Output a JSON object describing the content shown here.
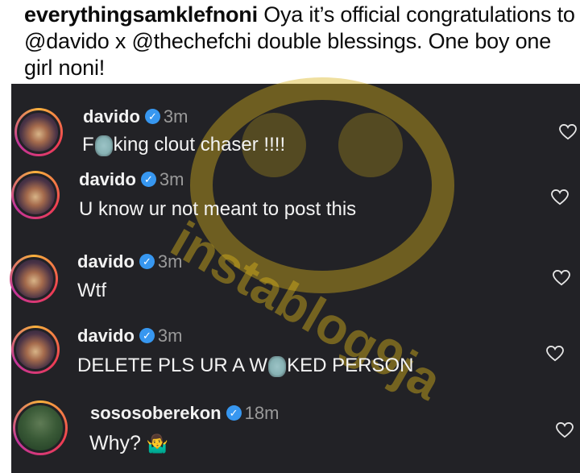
{
  "caption": {
    "username": "everythingsamklefnoni",
    "text": " Oya it’s official congratulations to @davido x @thechefchi double blessings. One boy one girl noni!"
  },
  "watermark": {
    "text": "instablog9ja"
  },
  "comments": [
    {
      "username": "davido",
      "time": "3m",
      "text_before": "F",
      "text_after": "king clout chaser !!!!",
      "avatar_icon": "davido-avatar-icon"
    },
    {
      "username": "davido",
      "time": "3m",
      "text": "U know ur not meant to post this",
      "avatar_icon": "davido-avatar-icon"
    },
    {
      "username": "davido",
      "time": "3m",
      "text": "Wtf",
      "avatar_icon": "davido-avatar-icon"
    },
    {
      "username": "davido",
      "time": "3m",
      "text_before": "DELETE PLS UR A W",
      "text_after": "KED  PERSON",
      "avatar_icon": "davido-avatar-icon"
    },
    {
      "username": "sososoberekon",
      "time": "18m",
      "text": "Why? ",
      "emoji": "person-shrugging-icon",
      "avatar_icon": "sososoberekon-avatar-icon"
    }
  ],
  "colors": {
    "background": "#222226",
    "verified": "#3797f0",
    "watermark": "#d9b31a"
  }
}
